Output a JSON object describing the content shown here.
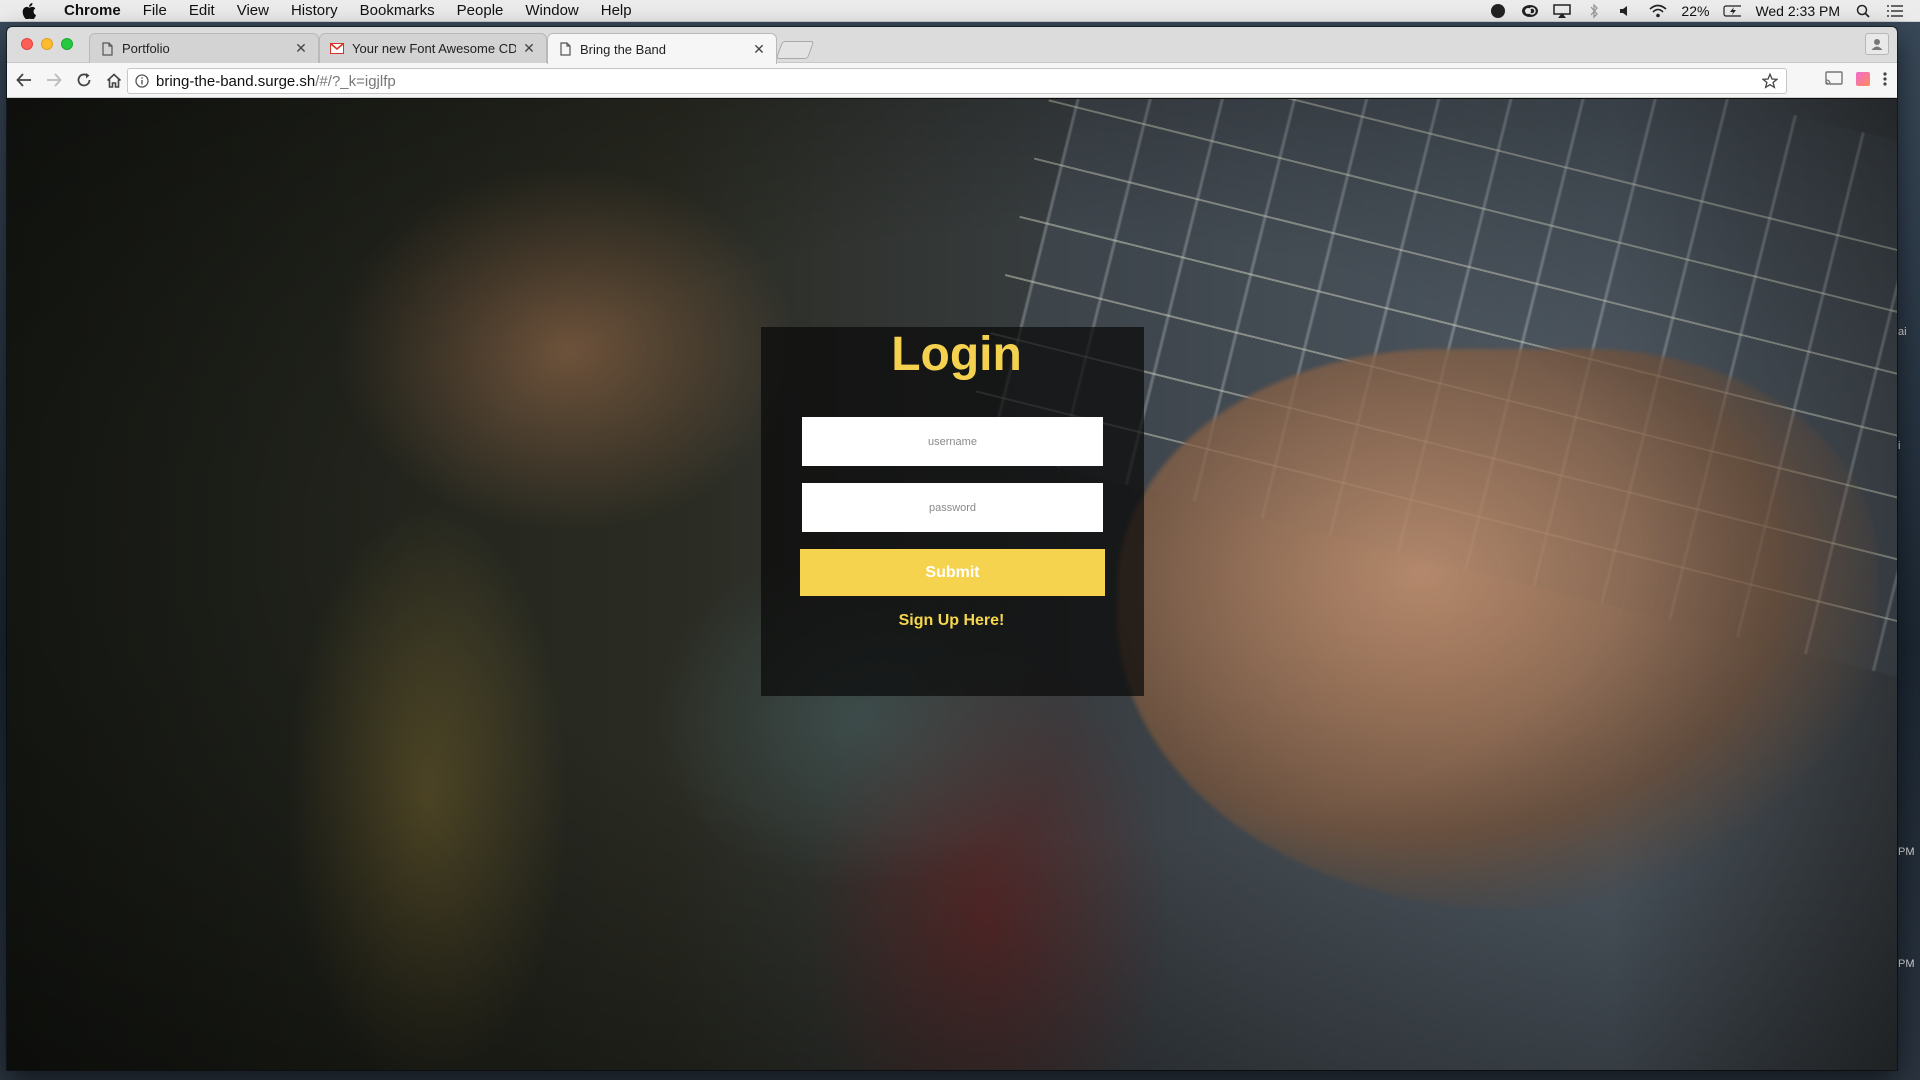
{
  "menubar": {
    "app_name": "Chrome",
    "menus": [
      "File",
      "Edit",
      "View",
      "History",
      "Bookmarks",
      "People",
      "Window",
      "Help"
    ],
    "battery": "22%",
    "clock": "Wed 2:33 PM"
  },
  "browser": {
    "tabs": [
      {
        "title": "Portfolio",
        "icon": "page-icon"
      },
      {
        "title": "Your new Font Awesome CDN",
        "icon": "gmail-icon"
      },
      {
        "title": "Bring the Band",
        "icon": "page-icon"
      }
    ],
    "url_host": "bring-the-band.surge.sh",
    "url_path": "/#/?_k=igjlfp"
  },
  "login": {
    "title": "Login",
    "username_placeholder": "username",
    "password_placeholder": "password",
    "submit_label": "Submit",
    "signup_label": "Sign Up Here!"
  },
  "colors": {
    "accent_yellow": "#f5d34f",
    "panel_bg": "rgba(10,10,10,0.72)"
  },
  "desktop_edge": [
    "ai",
    "i",
    "PM",
    "PM"
  ]
}
